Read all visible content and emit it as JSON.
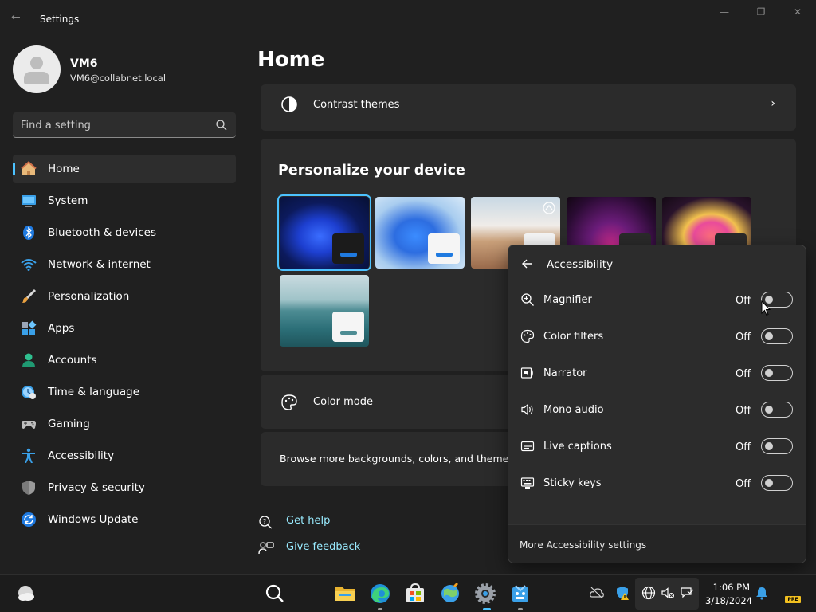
{
  "window": {
    "title": "Settings",
    "back_glyph": "←",
    "minimize_glyph": "—",
    "restore_glyph": "❐",
    "close_glyph": "✕"
  },
  "user": {
    "name": "VM6",
    "email": "VM6@collabnet.local"
  },
  "search": {
    "placeholder": "Find a setting"
  },
  "sidebar": {
    "items": [
      {
        "label": "Home",
        "icon": "home-icon",
        "active": true
      },
      {
        "label": "System",
        "icon": "system-icon"
      },
      {
        "label": "Bluetooth & devices",
        "icon": "bluetooth-icon"
      },
      {
        "label": "Network & internet",
        "icon": "wifi-icon"
      },
      {
        "label": "Personalization",
        "icon": "brush-icon"
      },
      {
        "label": "Apps",
        "icon": "apps-icon"
      },
      {
        "label": "Accounts",
        "icon": "accounts-icon"
      },
      {
        "label": "Time & language",
        "icon": "clock-globe-icon"
      },
      {
        "label": "Gaming",
        "icon": "gamepad-icon"
      },
      {
        "label": "Accessibility",
        "icon": "accessibility-icon"
      },
      {
        "label": "Privacy & security",
        "icon": "shield-icon"
      },
      {
        "label": "Windows Update",
        "icon": "update-icon"
      }
    ]
  },
  "main": {
    "page_title": "Home",
    "contrast_themes": {
      "label": "Contrast themes",
      "chevron": "›"
    },
    "personalize": {
      "title": "Personalize your device",
      "themes": [
        {
          "name": "windows-light-bloom",
          "selected": true
        },
        {
          "name": "windows-bloom-light"
        },
        {
          "name": "spotlight-landscape"
        },
        {
          "name": "glow-purple"
        },
        {
          "name": "captured-motion-flower"
        },
        {
          "name": "sunrise-lake"
        }
      ],
      "color_mode_label": "Color mode",
      "browse_label": "Browse more backgrounds, colors, and themes"
    },
    "help": {
      "get_help": "Get help",
      "give_feedback": "Give feedback"
    }
  },
  "accessibility_flyout": {
    "back_glyph": "←",
    "title": "Accessibility",
    "rows": [
      {
        "label": "Magnifier",
        "state": "Off",
        "icon": "magnifier-icon",
        "on": false
      },
      {
        "label": "Color filters",
        "state": "Off",
        "icon": "color-filters-icon",
        "on": false
      },
      {
        "label": "Narrator",
        "state": "Off",
        "icon": "narrator-icon",
        "on": false
      },
      {
        "label": "Mono audio",
        "state": "Off",
        "icon": "mono-audio-icon",
        "on": false
      },
      {
        "label": "Live captions",
        "state": "Off",
        "icon": "live-captions-icon",
        "on": false
      },
      {
        "label": "Sticky keys",
        "state": "Off",
        "icon": "sticky-keys-icon",
        "on": false
      }
    ],
    "footer": "More Accessibility settings"
  },
  "taskbar": {
    "clock_time": "1:06 PM",
    "clock_date": "3/18/2024",
    "badge": "PRE"
  },
  "colors": {
    "accent": "#4cc2ff",
    "link": "#99ebff",
    "background": "#202020",
    "card": "#2b2b2b"
  }
}
